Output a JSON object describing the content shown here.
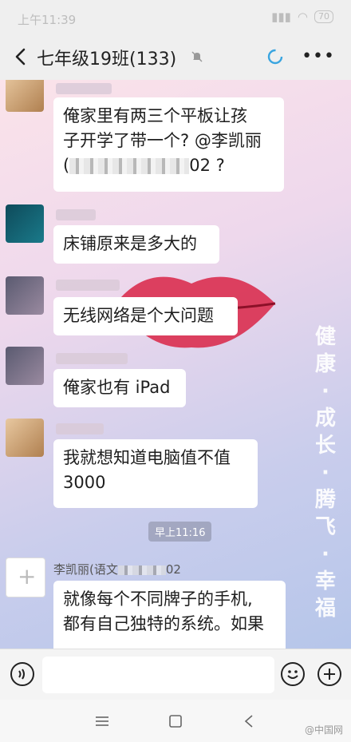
{
  "status": {
    "time": "上午11:39",
    "battery": "70"
  },
  "header": {
    "title": "七年级19班(133)"
  },
  "motto": [
    "健",
    "康",
    "·",
    "成",
    "长",
    "·",
    "腾",
    "飞",
    "·",
    "幸",
    "福"
  ],
  "messages": [
    {
      "lines": [
        "俺家里有两三个平板让孩",
        "子开学了带一个? @李凯丽"
      ],
      "line3_end": "02 ?"
    },
    {
      "text": "床铺原来是多大的"
    },
    {
      "text": "无线网络是个大问题"
    },
    {
      "text": "俺家也有 iPad"
    },
    {
      "lines": [
        "我就想知道电脑值不值",
        "3000"
      ]
    },
    {
      "lines": [
        "就像每个不同牌子的手机,",
        "都有自己独特的系统。如果"
      ]
    }
  ],
  "time_chip": "早上11:16",
  "sender_partial": "李凯丽(语文",
  "sender_suffix": "02",
  "watermark": "@中国网"
}
